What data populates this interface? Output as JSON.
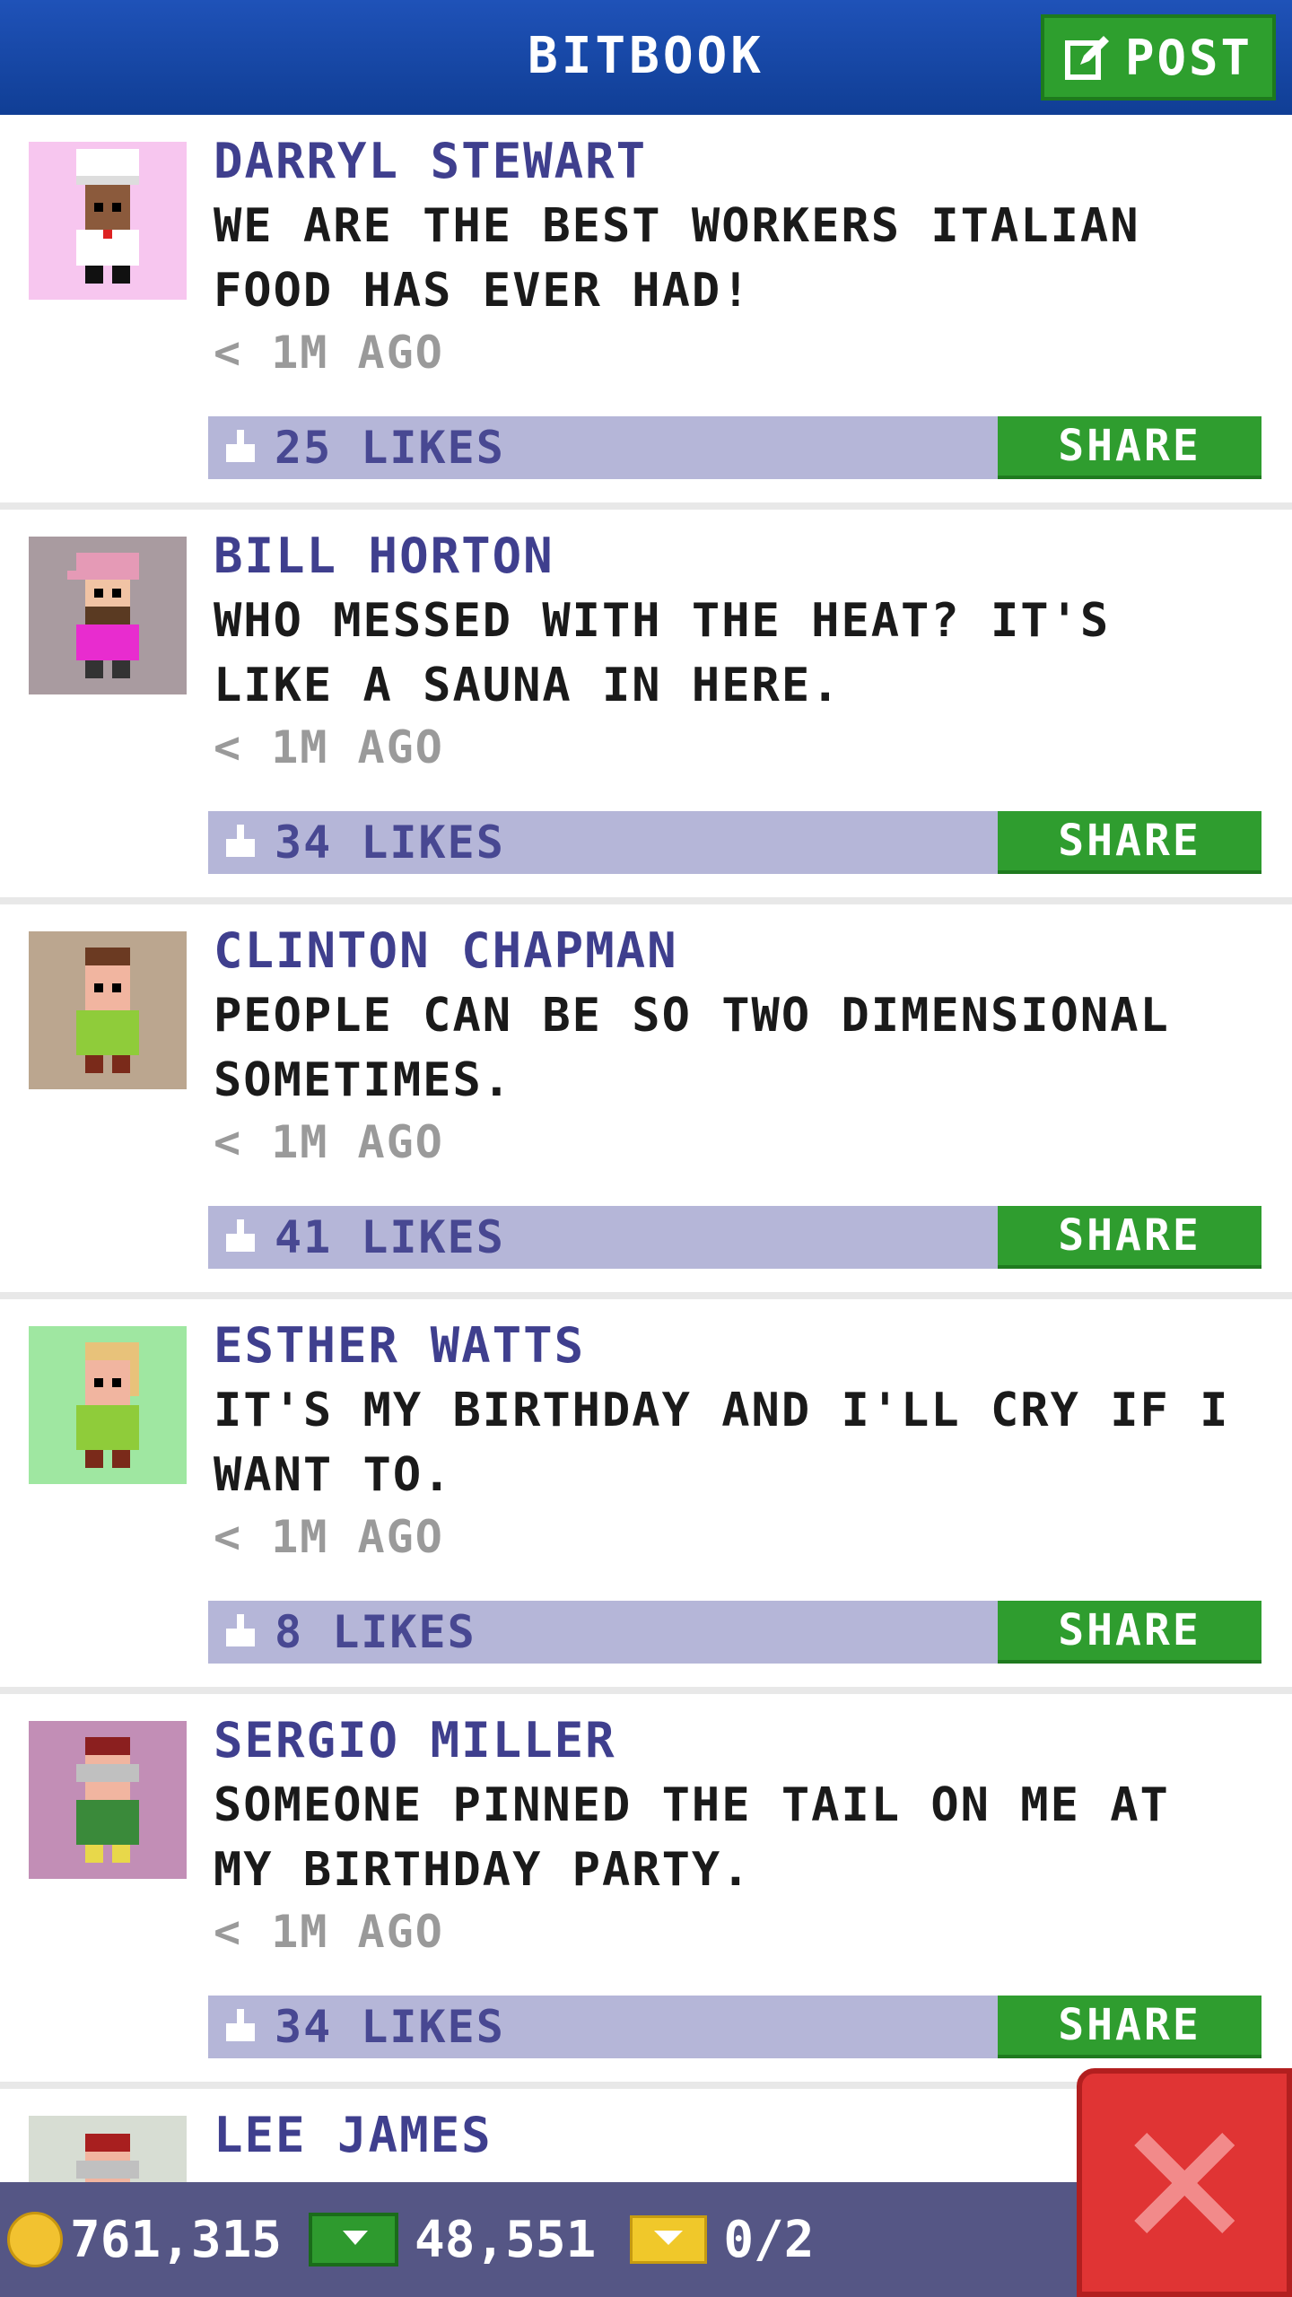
{
  "header": {
    "title": "BITBOOK",
    "post_label": "POST"
  },
  "posts": [
    {
      "name": "DARRYL STEWART",
      "message": "WE ARE THE BEST WORKERS ITALIAN FOOD HAS EVER HAD!",
      "time": "< 1M AGO",
      "likes": "25 LIKES",
      "share": "SHARE",
      "avatar_bg": "#f7c6ef",
      "avatar": "chef-avatar"
    },
    {
      "name": "BILL HORTON",
      "message": "WHO MESSED WITH THE HEAT? IT'S LIKE A SAUNA IN HERE.",
      "time": "< 1M AGO",
      "likes": "34 LIKES",
      "share": "SHARE",
      "avatar_bg": "#a99ba0",
      "avatar": "bearded-cap-avatar"
    },
    {
      "name": "CLINTON CHAPMAN",
      "message": "PEOPLE CAN BE SO TWO DIMENSIONAL SOMETIMES.",
      "time": "< 1M AGO",
      "likes": "41 LIKES",
      "share": "SHARE",
      "avatar_bg": "#bba68f",
      "avatar": "person-avatar"
    },
    {
      "name": "ESTHER WATTS",
      "message": "IT'S MY BIRTHDAY AND I'LL CRY IF I WANT TO.",
      "time": "< 1M AGO",
      "likes": "8 LIKES",
      "share": "SHARE",
      "avatar_bg": "#9fe7a1",
      "avatar": "blonde-avatar"
    },
    {
      "name": "SERGIO MILLER",
      "message": "SOMEONE PINNED THE TAIL ON ME AT MY BIRTHDAY PARTY.",
      "time": "< 1M AGO",
      "likes": "34 LIKES",
      "share": "SHARE",
      "avatar_bg": "#c28eb6",
      "avatar": "glasses-avatar"
    },
    {
      "name": "LEE JAMES",
      "message": "",
      "time": "",
      "likes": "",
      "share": "",
      "avatar_bg": "#d7ddd3",
      "avatar": "red-hair-avatar"
    }
  ],
  "status": {
    "coins": "761,315",
    "bux": "48,551",
    "tickets": "0/2"
  },
  "colors": {
    "header": "#1a4aa8",
    "share": "#2f9d2f",
    "likes_bar": "#b5b6d8",
    "status": "#555685",
    "close": "#e03434"
  }
}
